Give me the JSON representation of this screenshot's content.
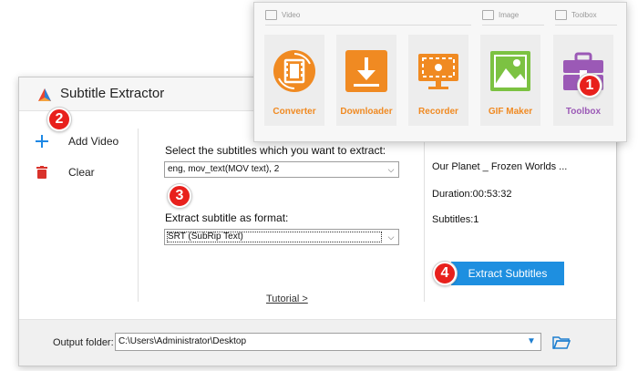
{
  "app": {
    "title": "Subtitle Extractor"
  },
  "sidebar": {
    "add_video_label": "Add Video",
    "clear_label": "Clear"
  },
  "center": {
    "select_subtitles_label": "Select the subtitles which you want to extract:",
    "subtitle_track_value": "eng, mov_text(MOV text), 2",
    "format_label": "Extract subtitle as format:",
    "format_value": "SRT (SubRip Text)",
    "tutorial_link": "Tutorial >"
  },
  "info": {
    "file_name": "Our Planet _ Frozen Worlds ...",
    "duration": "Duration:00:53:32",
    "subtitles": "Subtitles:1",
    "extract_button": "Extract Subtitles"
  },
  "output": {
    "label": "Output folder:",
    "path": "C:\\Users\\Administrator\\Desktop"
  },
  "toolbox_window": {
    "sections": {
      "video": "Video",
      "image": "Image",
      "toolbox": "Toolbox"
    },
    "tools": [
      {
        "label": "Converter",
        "icon": "film-reel-icon"
      },
      {
        "label": "Downloader",
        "icon": "download-arrow-icon"
      },
      {
        "label": "Recorder",
        "icon": "screen-record-icon"
      },
      {
        "label": "GIF Maker",
        "icon": "image-landscape-icon"
      },
      {
        "label": "Toolbox",
        "icon": "toolbox-icon"
      }
    ]
  },
  "steps": [
    "1",
    "2",
    "3",
    "4"
  ],
  "colors": {
    "accent_orange": "#f08a22",
    "extract_button_blue": "#1e8fe0",
    "badge_red": "#e8201c",
    "gif_green": "#7cc242",
    "toolbox_purple": "#9b59b6",
    "clear_red": "#d9322b",
    "add_blue": "#1e88e5"
  }
}
